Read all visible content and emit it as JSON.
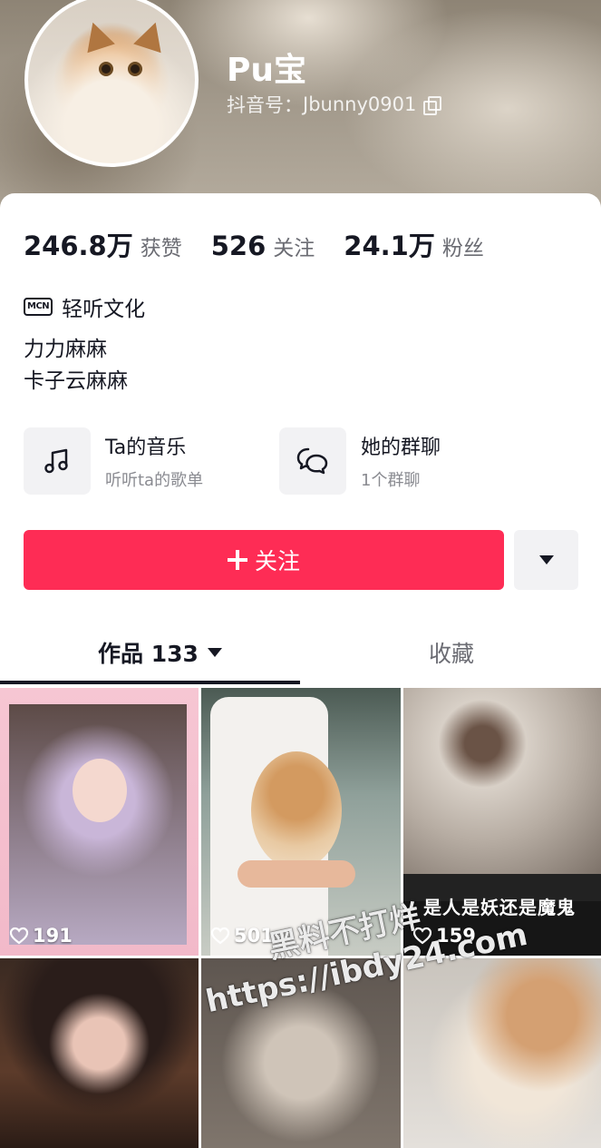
{
  "profile": {
    "name": "Pu宝",
    "account_label": "抖音号：",
    "account_id": "Jbunny0901"
  },
  "stats": [
    {
      "value": "246.8万",
      "label": "获赞"
    },
    {
      "value": "526",
      "label": "关注"
    },
    {
      "value": "24.1万",
      "label": "粉丝"
    }
  ],
  "mcn": {
    "icon_text": "MCN",
    "name": "轻听文化"
  },
  "bio": {
    "line1": "力力麻麻",
    "line2": "卡子云麻麻"
  },
  "features": {
    "music": {
      "title": "Ta的音乐",
      "subtitle": "听听ta的歌单",
      "icon": "music-note-icon"
    },
    "group": {
      "title": "她的群聊",
      "subtitle": "1个群聊",
      "icon": "chat-bubbles-icon"
    }
  },
  "actions": {
    "follow_label": "关注",
    "more_icon": "chevron-down-icon"
  },
  "tabs": {
    "works_label": "作品 133",
    "favorites_label": "收藏"
  },
  "videos": [
    {
      "likes": "191"
    },
    {
      "likes": "501"
    },
    {
      "likes": "159",
      "caption": "是人是妖还是魔鬼"
    },
    {
      "likes": ""
    },
    {
      "likes": ""
    },
    {
      "likes": ""
    }
  ],
  "watermark": {
    "line1": "黑料不打烊",
    "line2": "https://ibdy24.com"
  },
  "colors": {
    "accent": "#fe2c55",
    "text": "#161823",
    "secondary": "#6b6c73"
  }
}
